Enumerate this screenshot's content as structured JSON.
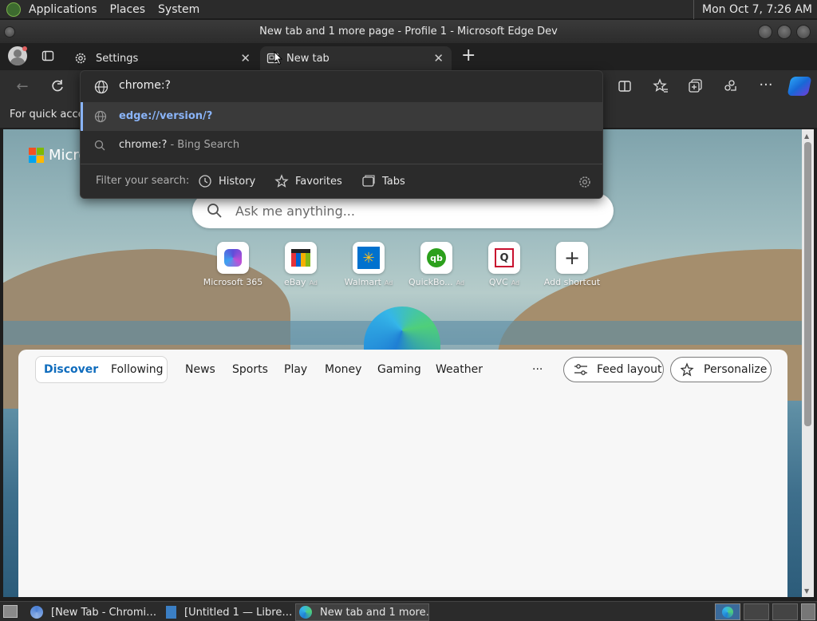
{
  "system_bar": {
    "menu": [
      "Applications",
      "Places",
      "System"
    ],
    "clock": "Mon Oct  7,  7:26 AM"
  },
  "window": {
    "title": "New tab and 1 more page - Profile 1 - Microsoft Edge Dev"
  },
  "tabs": [
    {
      "label": "Settings",
      "icon": "gear-icon"
    },
    {
      "label": "New tab",
      "icon": "new-tab-icon"
    }
  ],
  "favorites_bar": {
    "text": "For quick acces"
  },
  "address_bar": {
    "value": "chrome:?"
  },
  "dropdown": {
    "suggestions": [
      {
        "text": "edge://version/?",
        "suffix": "",
        "icon": "globe-icon"
      },
      {
        "text": "chrome:?",
        "suffix": " - Bing Search",
        "icon": "search-icon"
      }
    ],
    "filter_label": "Filter your search:",
    "filters": [
      "History",
      "Favorites",
      "Tabs"
    ]
  },
  "new_tab_page": {
    "brand": "Micro",
    "search_placeholder": "Ask me anything...",
    "tiles": [
      {
        "label": "Microsoft 365",
        "ad": ""
      },
      {
        "label": "eBay",
        "ad": "Ad"
      },
      {
        "label": "Walmart",
        "ad": "Ad"
      },
      {
        "label": "QuickBo...",
        "ad": "Ad"
      },
      {
        "label": "QVC",
        "ad": "Ad"
      },
      {
        "label": "Add shortcut",
        "ad": ""
      }
    ],
    "feed": {
      "tabs": [
        "Discover",
        "Following"
      ],
      "categories": [
        "News",
        "Sports",
        "Play",
        "Money",
        "Gaming",
        "Weather"
      ],
      "more": "···",
      "feed_layout": "Feed layout",
      "personalize": "Personalize"
    }
  },
  "taskbar": {
    "items": [
      {
        "label": "[New Tab - Chromi…"
      },
      {
        "label": "[Untitled 1 — Libre…"
      },
      {
        "label": "New tab and 1 more…"
      }
    ]
  },
  "colors": {
    "accent": "#0f6cbd",
    "link_blue": "#8ab4f8",
    "dark_bg": "#2e2e2e"
  }
}
